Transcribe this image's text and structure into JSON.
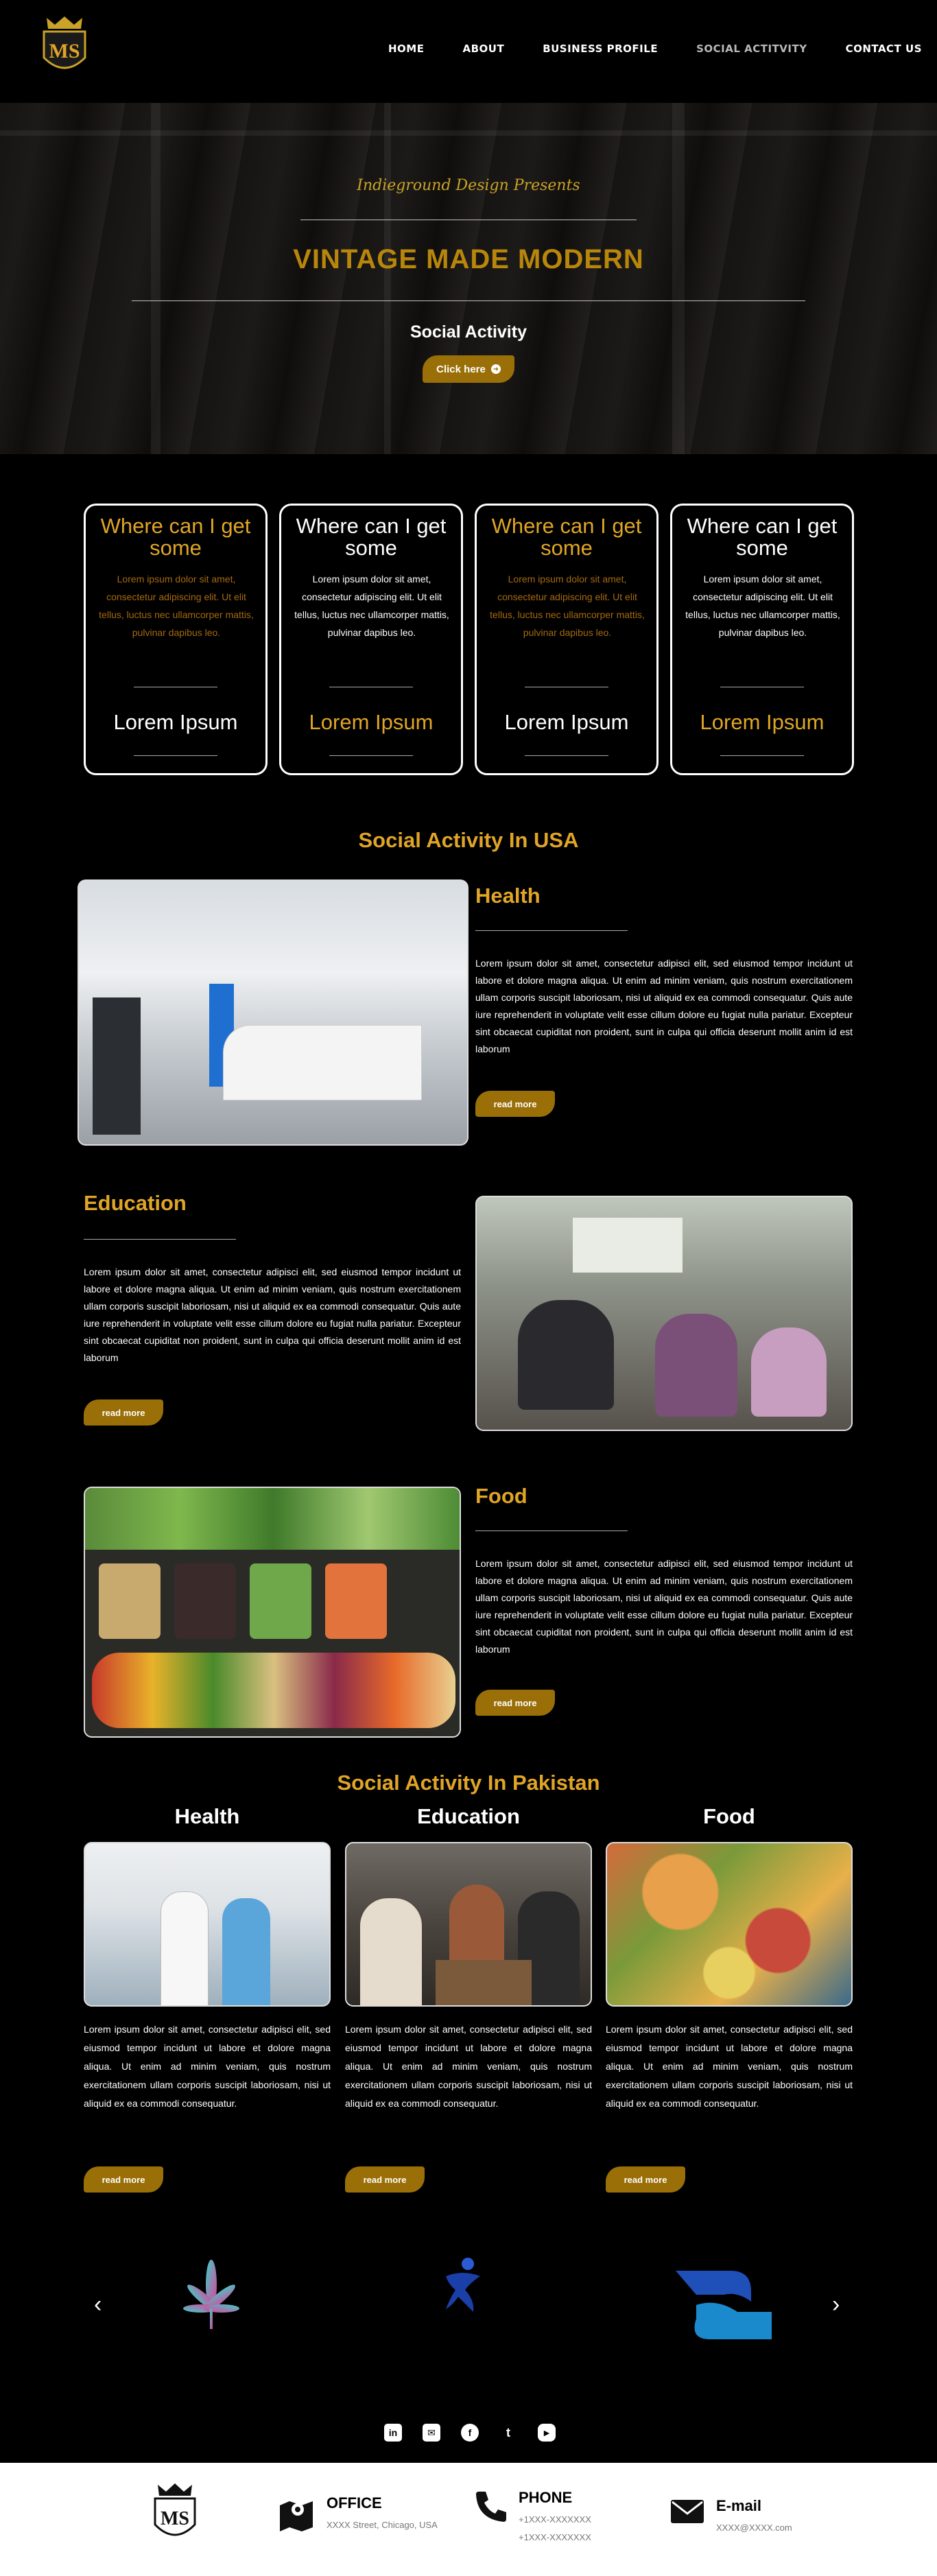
{
  "header": {
    "nav": [
      "HOME",
      "ABOUT",
      "BUSINESS PROFILE",
      "SOCIAL ACTITVITY",
      "CONTACT US"
    ],
    "active_index": 3,
    "logo_text": "MS"
  },
  "hero": {
    "pre": "Indieground Design Presents",
    "title": "VINTAGE MADE MODERN",
    "subtitle": "Social Activity",
    "button": "Click here"
  },
  "cards": [
    {
      "title": "Where can I get some",
      "text": "Lorem ipsum dolor sit amet, consectetur adipiscing elit. Ut elit tellus, luctus nec ullamcorper mattis, pulvinar dapibus leo.",
      "big": "Lorem Ipsum",
      "title_color": "#e0a526",
      "text_color": "#a66a10",
      "big_color": "#ffffff"
    },
    {
      "title": "Where can I get some",
      "text": "Lorem ipsum dolor sit amet, consectetur adipiscing elit. Ut elit tellus, luctus nec ullamcorper mattis, pulvinar dapibus leo.",
      "big": "Lorem Ipsum",
      "title_color": "#ffffff",
      "text_color": "#ffffff",
      "big_color": "#e0a526"
    },
    {
      "title": "Where can I get some",
      "text": "Lorem ipsum dolor sit amet, consectetur adipiscing elit. Ut elit tellus, luctus nec ullamcorper mattis, pulvinar dapibus leo.",
      "big": "Lorem Ipsum",
      "title_color": "#e0a526",
      "text_color": "#a66a10",
      "big_color": "#ffffff"
    },
    {
      "title": "Where can I get some",
      "text": "Lorem ipsum dolor sit amet, consectetur adipiscing elit. Ut elit tellus, luctus nec ullamcorper mattis, pulvinar dapibus leo.",
      "big": "Lorem Ipsum",
      "title_color": "#ffffff",
      "text_color": "#ffffff",
      "big_color": "#e0a526"
    }
  ],
  "usa": {
    "title": "Social Activity In USA",
    "items": [
      {
        "heading": "Health",
        "text": "Lorem ipsum dolor sit amet, consectetur adipisci elit, sed eiusmod tempor incidunt ut labore et dolore magna aliqua. Ut enim ad minim veniam, quis nostrum exercitationem ullam corporis suscipit laboriosam, nisi ut aliquid ex ea commodi consequatur. Quis aute iure reprehenderit in voluptate velit esse cillum dolore eu fugiat nulla pariatur. Excepteur sint obcaecat cupiditat non proident, sunt in culpa qui officia deserunt mollit anim id est laborum",
        "button": "read more"
      },
      {
        "heading": "Education",
        "text": "Lorem ipsum dolor sit amet, consectetur adipisci elit, sed eiusmod tempor incidunt ut labore et dolore magna aliqua. Ut enim ad minim veniam, quis nostrum exercitationem ullam corporis suscipit laboriosam, nisi ut aliquid ex ea commodi consequatur. Quis aute iure reprehenderit in voluptate velit esse cillum dolore eu fugiat nulla pariatur. Excepteur sint obcaecat cupiditat non proident, sunt in culpa qui officia deserunt mollit anim id est laborum",
        "button": "read more"
      },
      {
        "heading": "Food",
        "text": "Lorem ipsum dolor sit amet, consectetur adipisci elit, sed eiusmod tempor incidunt ut labore et dolore magna aliqua. Ut enim ad minim veniam, quis nostrum exercitationem ullam corporis suscipit laboriosam, nisi ut aliquid ex ea commodi consequatur. Quis aute iure reprehenderit in voluptate velit esse cillum dolore eu fugiat nulla pariatur. Excepteur sint obcaecat cupiditat non proident, sunt in culpa qui officia deserunt mollit anim id est laborum",
        "button": "read more"
      }
    ]
  },
  "pakistan": {
    "title": "Social Activity In Pakistan",
    "cols": [
      {
        "heading": "Health",
        "text": "Lorem ipsum dolor sit amet, consectetur adipisci elit, sed eiusmod tempor incidunt ut labore et dolore magna aliqua. Ut enim ad minim veniam, quis nostrum exercitationem ullam corporis suscipit laboriosam, nisi ut aliquid ex ea commodi consequatur.",
        "button": "read more"
      },
      {
        "heading": "Education",
        "text": "Lorem ipsum dolor sit amet, consectetur adipisci elit, sed eiusmod tempor incidunt ut labore et dolore magna aliqua. Ut enim ad minim veniam, quis nostrum exercitationem ullam corporis suscipit laboriosam, nisi ut aliquid ex ea commodi consequatur.",
        "button": "read more"
      },
      {
        "heading": "Food",
        "text": "Lorem ipsum dolor sit amet, consectetur adipisci elit, sed eiusmod tempor incidunt ut labore et dolore magna aliqua. Ut enim ad minim veniam, quis nostrum exercitationem ullam corporis suscipit laboriosam, nisi ut aliquid ex ea commodi consequatur.",
        "button": "read more"
      }
    ]
  },
  "carousel": {
    "prev": "‹",
    "next": "›",
    "icons": [
      "cannabis-leaf-icon",
      "dancer-figure-icon",
      "helping-hands-icon"
    ]
  },
  "social": {
    "icons": [
      "linkedin-icon",
      "email-icon",
      "facebook-icon",
      "twitter-icon",
      "youtube-icon"
    ],
    "glyphs": [
      "in",
      "✉",
      "f",
      "t",
      "▶"
    ]
  },
  "footer": {
    "logo_text": "MS",
    "office": {
      "label": "OFFICE",
      "value": "XXXX Street, Chicago, USA"
    },
    "phone": {
      "label": "PHONE",
      "values": [
        "+1XXX-XXXXXXX",
        "+1XXX-XXXXXXX"
      ]
    },
    "email": {
      "label": "E-mail",
      "value": "XXXX@XXXX.com"
    }
  },
  "colors": {
    "gold": "#e0a526",
    "button": "#9a6f08",
    "bg": "#000000",
    "footer_bg": "#ffffff"
  }
}
